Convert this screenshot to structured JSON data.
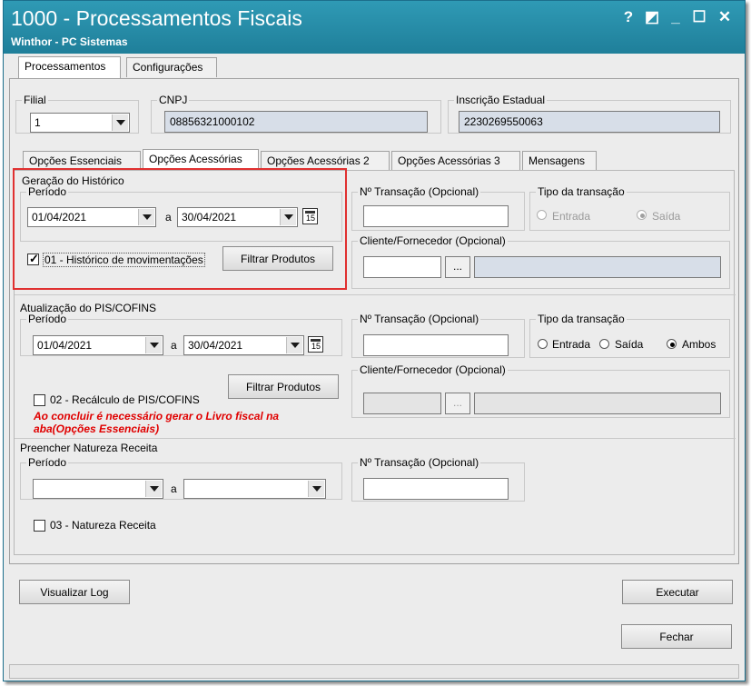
{
  "window": {
    "title": "1000 - Processamentos Fiscais",
    "subtitle": "Winthor - PC Sistemas",
    "buttons": {
      "help": "?",
      "restore": "◩",
      "minimize": "_",
      "maximize": "☐",
      "close": "✕"
    }
  },
  "top_tabs": [
    "Processamentos",
    "Configurações"
  ],
  "filial": {
    "label": "Filial",
    "value": "1"
  },
  "cnpj": {
    "label": "CNPJ",
    "value": "08856321000102"
  },
  "inscricao": {
    "label": "Inscrição Estadual",
    "value": "2230269550063"
  },
  "sub_tabs": [
    "Opções Essenciais",
    "Opções Acessórias",
    "Opções Acessórias 2",
    "Opções Acessórias 3",
    "Mensagens"
  ],
  "historico": {
    "title": "Geração do Histórico",
    "periodo_label": "Período",
    "date_from": "01/04/2021",
    "a_label": "a",
    "date_to": "30/04/2021",
    "checkbox_label": "01 - Histórico de movimentações",
    "filter_button": "Filtrar Produtos",
    "transacao_label": "Nº Transação (Opcional)",
    "tipo_label": "Tipo da transação",
    "tipo_options": [
      "Entrada",
      "Saída"
    ],
    "cliente_label": "Cliente/Fornecedor (Opcional)",
    "ellipsis": "..."
  },
  "pis": {
    "title": "Atualização do PIS/COFINS",
    "periodo_label": "Período",
    "date_from": "01/04/2021",
    "a_label": "a",
    "date_to": "30/04/2021",
    "transacao_label": "Nº Transação (Opcional)",
    "tipo_label": "Tipo da transação",
    "tipo_options": [
      "Entrada",
      "Saída",
      "Ambos"
    ],
    "filter_button": "Filtrar Produtos",
    "cliente_label": "Cliente/Fornecedor (Opcional)",
    "ellipsis": "...",
    "checkbox_label": "02 - Recálculo de PIS/COFINS",
    "warning_line1": "Ao concluir é necessário gerar o Livro fiscal na",
    "warning_line2": "aba(Opções Essenciais)"
  },
  "natureza": {
    "title": "Preencher Natureza Receita",
    "periodo_label": "Período",
    "a_label": "a",
    "transacao_label": "Nº Transação (Opcional)",
    "checkbox_label": "03 - Natureza Receita"
  },
  "footer": {
    "log_button": "Visualizar Log",
    "executar_button": "Executar",
    "fechar_button": "Fechar"
  },
  "colors": {
    "title_bar": "#2789A8",
    "highlight_box": "#E03030",
    "readonly_field": "#D7DEE8",
    "warning_text": "#E00000"
  }
}
